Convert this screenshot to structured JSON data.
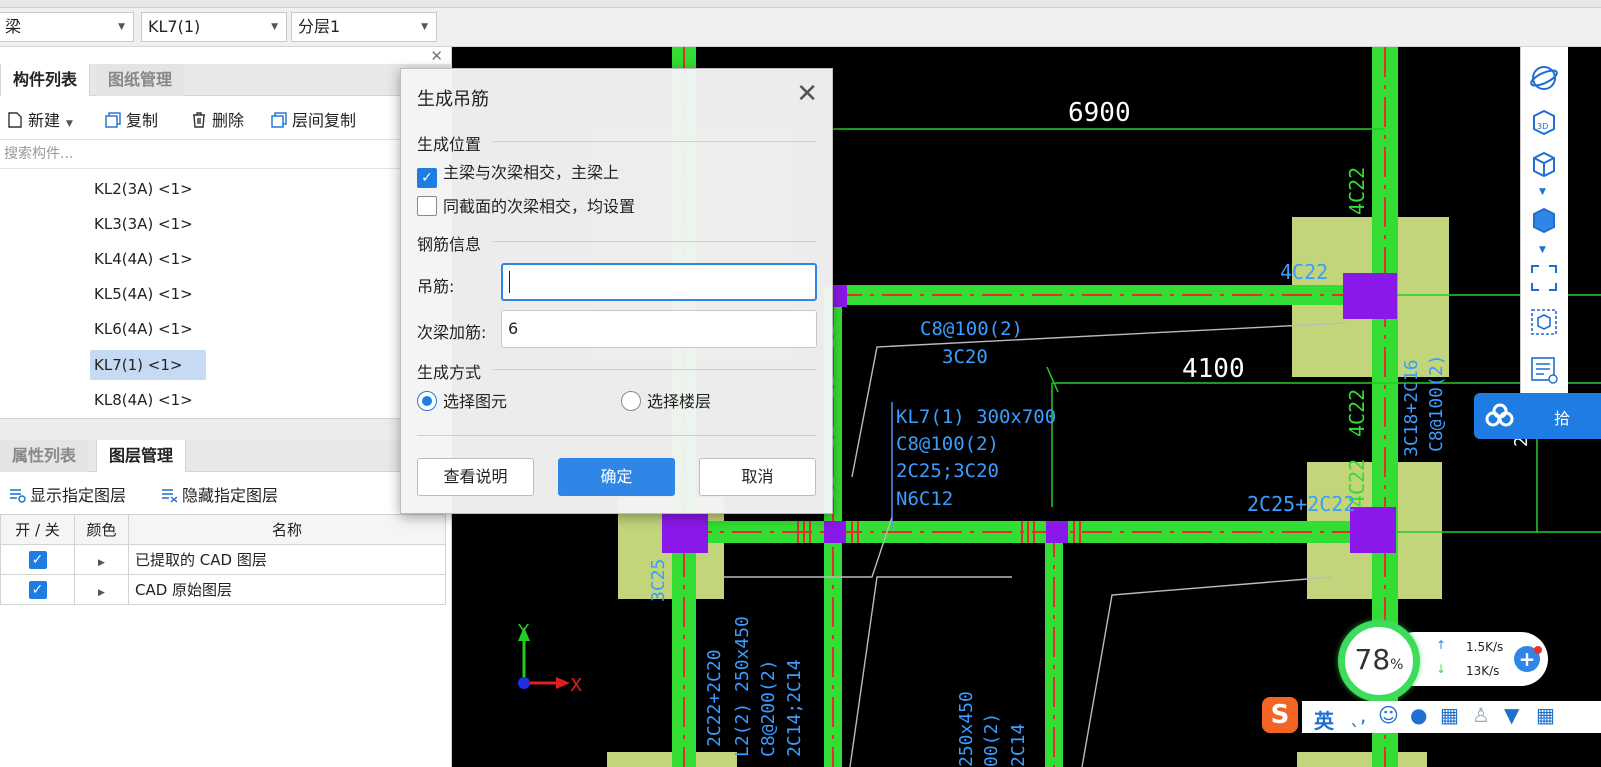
{
  "toolbar": {
    "combo1": "梁",
    "combo2": "KL7(1)",
    "combo3": "分层1"
  },
  "component_panel": {
    "tabs": [
      "构件列表",
      "图纸管理"
    ],
    "actions": {
      "new": "新建",
      "copy": "复制",
      "delete": "删除",
      "floor_copy": "层间复制"
    },
    "search_placeholder": "搜索构件...",
    "items": [
      "KL2(3A) <1>",
      "KL3(3A) <1>",
      "KL4(4A) <1>",
      "KL5(4A) <1>",
      "KL6(4A) <1>",
      "KL7(1) <1>",
      "KL8(4A) <1>"
    ],
    "selected_index": 5
  },
  "layer_panel": {
    "tabs": [
      "属性列表",
      "图层管理"
    ],
    "actions": {
      "show": "显示指定图层",
      "hide": "隐藏指定图层"
    },
    "columns": [
      "开 / 关",
      "颜色",
      "名称"
    ],
    "rows": [
      {
        "on": true,
        "name": "已提取的 CAD 图层"
      },
      {
        "on": true,
        "name": "CAD 原始图层"
      }
    ]
  },
  "dialog": {
    "title": "生成吊筋",
    "section_position": "生成位置",
    "check_main_secondary": "主梁与次梁相交，主梁上",
    "check_main_secondary_checked": true,
    "check_same_section": "同截面的次梁相交，均设置",
    "check_same_section_checked": false,
    "section_rebar": "钢筋信息",
    "label_hanger": "吊筋:",
    "value_hanger": "",
    "label_secondary_add": "次梁加筋:",
    "value_secondary_add": "6",
    "section_method": "生成方式",
    "radio_select_element": "选择图元",
    "radio_select_floor": "选择楼层",
    "radio_selected": "选择图元",
    "btn_help": "查看说明",
    "btn_ok": "确定",
    "btn_cancel": "取消"
  },
  "drawing": {
    "dim_top": "6900",
    "dim_mid": "4100",
    "texts": {
      "c1": "4C22",
      "c2": "4C22",
      "c3": "C8@100(2)",
      "c4": "3C20",
      "c5": "KL7(1) 300x700",
      "c6": "C8@100(2)",
      "c7": "2C25;3C20",
      "c8": "N6C12",
      "c9": "4C22",
      "c10": "4C22",
      "c11": "2C25+2C22",
      "c12": "3C18+2C16",
      "c13": "C8@100(2)",
      "c14": "3C25",
      "c15": "2C22+2C20",
      "c16": "L2(2) 250x450",
      "c17": "C8@200(2)",
      "c18": "2C14;2C14",
      "c19": "250x450",
      "c20": "00(2)",
      "c21": "2C14",
      "axis_x": "X",
      "axis_y": "Y",
      "partial_right": "2"
    }
  },
  "network_widget": {
    "percent": "78",
    "percent_unit": "%",
    "up": "1.5K/s",
    "down": "13K/s"
  },
  "cloud_widget": {
    "text": "拾"
  },
  "ime": {
    "lang": "英"
  }
}
